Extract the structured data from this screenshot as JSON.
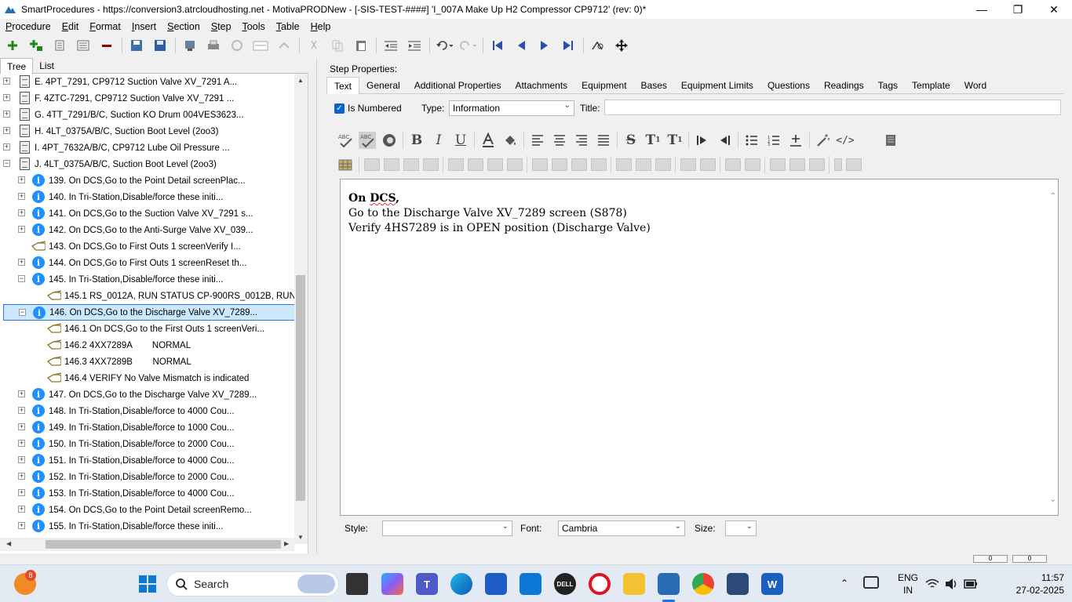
{
  "window": {
    "title": "SmartProcedures - https://conversion3.atrcloudhosting.net - MotivaPRODNew - [-SIS-TEST-####] 'I_007A Make Up H2 Compressor CP9712' (rev: 0)*"
  },
  "menu": [
    "Procedure",
    "Edit",
    "Format",
    "Insert",
    "Section",
    "Step",
    "Tools",
    "Table",
    "Help"
  ],
  "left_tabs": [
    "Tree",
    "List"
  ],
  "tree": [
    {
      "label": "E. 4PT_7291, CP9712 Suction Valve XV_7291 A...",
      "icon": "section-doc-icon",
      "level": 0,
      "expander": "+"
    },
    {
      "label": "F. 4ZTC-7291, CP9712 Suction Valve XV_7291 ...",
      "icon": "section-doc-icon",
      "level": 0,
      "expander": "+"
    },
    {
      "label": "G. 4TT_7291/B/C, Suction KO Drum 004VES3623...",
      "icon": "section-doc-icon",
      "level": 0,
      "expander": "+"
    },
    {
      "label": "H. 4LT_0375A/B/C, Suction Boot Level (2oo3)",
      "icon": "section-doc-icon",
      "level": 0,
      "expander": "+"
    },
    {
      "label": "I. 4PT_7632A/B/C, CP9712 Lube Oil Pressure ...",
      "icon": "section-doc-icon",
      "level": 0,
      "expander": "+"
    },
    {
      "label": "J. 4LT_0375A/B/C, Suction Boot Level (2oo3)",
      "icon": "section-doc-icon",
      "level": 0,
      "expander": "-"
    },
    {
      "label": "139. On DCS,Go to the Point Detail screenPlac...",
      "icon": "info-icon",
      "level": 1,
      "expander": "+"
    },
    {
      "label": "140. In Tri-Station,Disable/force these initi...",
      "icon": "info-icon",
      "level": 1,
      "expander": "+"
    },
    {
      "label": "141. On DCS,Go to the Suction Valve XV_7291 s...",
      "icon": "info-icon",
      "level": 1,
      "expander": "+"
    },
    {
      "label": "142. On DCS,Go to the Anti-Surge Valve XV_039...",
      "icon": "info-icon",
      "level": 1,
      "expander": "+"
    },
    {
      "label": "143. On DCS,Go to First Outs 1 screenVerify I...",
      "icon": "hand-pointer-icon",
      "level": 1,
      "expander": ""
    },
    {
      "label": "144. On DCS,Go to First Outs 1 screenReset th...",
      "icon": "info-icon",
      "level": 1,
      "expander": "+"
    },
    {
      "label": "145. In Tri-Station,Disable/force these initi...",
      "icon": "info-icon",
      "level": 1,
      "expander": "-"
    },
    {
      "label": "145.1 RS_0012A, RUN STATUS CP-900RS_0012B, RUN...",
      "icon": "hand-pointer-icon",
      "level": 2,
      "expander": ""
    },
    {
      "label": "146. On DCS,Go to the Discharge Valve XV_7289...",
      "icon": "info-icon",
      "level": 1,
      "expander": "-",
      "selected": true
    },
    {
      "label": "146.1 On DCS,Go to the First Outs 1 screenVeri...",
      "icon": "hand-pointer-icon",
      "level": 2,
      "expander": ""
    },
    {
      "label": "146.2 4XX7289A        NORMAL",
      "icon": "hand-pointer-icon",
      "level": 2,
      "expander": ""
    },
    {
      "label": "146.3 4XX7289B        NORMAL",
      "icon": "hand-pointer-icon",
      "level": 2,
      "expander": ""
    },
    {
      "label": "146.4 VERIFY No Valve Mismatch is indicated",
      "icon": "hand-pointer-icon",
      "level": 2,
      "expander": ""
    },
    {
      "label": "147. On DCS,Go to the Discharge Valve XV_7289...",
      "icon": "info-icon",
      "level": 1,
      "expander": "+"
    },
    {
      "label": "148. In Tri-Station,Disable/force to 4000 Cou...",
      "icon": "info-icon",
      "level": 1,
      "expander": "+"
    },
    {
      "label": "149. In Tri-Station,Disable/force to 1000 Cou...",
      "icon": "info-icon",
      "level": 1,
      "expander": "+"
    },
    {
      "label": "150. In Tri-Station,Disable/force to 2000 Cou...",
      "icon": "info-icon",
      "level": 1,
      "expander": "+"
    },
    {
      "label": "151. In Tri-Station,Disable/force to 4000 Cou...",
      "icon": "info-icon",
      "level": 1,
      "expander": "+"
    },
    {
      "label": "152. In Tri-Station,Disable/force to 2000 Cou...",
      "icon": "info-icon",
      "level": 1,
      "expander": "+"
    },
    {
      "label": "153. In Tri-Station,Disable/force to 4000 Cou...",
      "icon": "info-icon",
      "level": 1,
      "expander": "+"
    },
    {
      "label": "154. On DCS,Go to the Point Detail screenRemo...",
      "icon": "info-icon",
      "level": 1,
      "expander": "+"
    },
    {
      "label": "155. In Tri-Station,Disable/force these initi...",
      "icon": "info-icon",
      "level": 1,
      "expander": "+"
    }
  ],
  "step_properties": {
    "heading": "Step Properties:",
    "tabs": [
      "Text",
      "General",
      "Additional Properties",
      "Attachments",
      "Equipment",
      "Bases",
      "Equipment Limits",
      "Questions",
      "Readings",
      "Tags",
      "Template",
      "Word"
    ],
    "is_numbered_label": "Is Numbered",
    "is_numbered": true,
    "type_label": "Type:",
    "type_value": "Information",
    "title_label": "Title:",
    "title_value": ""
  },
  "editor": {
    "line1": "On DCS,",
    "line2": "Go to the Discharge Valve XV_7289 screen (S878)",
    "line3": "Verify 4HS7289 is in OPEN position (Discharge Valve)"
  },
  "format_bar": {
    "style_label": "Style:",
    "style_value": "",
    "font_label": "Font:",
    "font_value": "Cambria",
    "size_label": "Size:",
    "size_value": ""
  },
  "status_boxes": [
    "0",
    "0"
  ],
  "taskbar": {
    "search_placeholder": "Search",
    "notification_count": "8",
    "lang_line1": "ENG",
    "lang_line2": "IN",
    "time": "11:57",
    "date": "27-02-2025"
  },
  "colors": {
    "accent": "#1e90ff",
    "selection_bg": "#cce8ff",
    "selection_border": "#3377cc",
    "editor_squiggle": "#e03030"
  }
}
